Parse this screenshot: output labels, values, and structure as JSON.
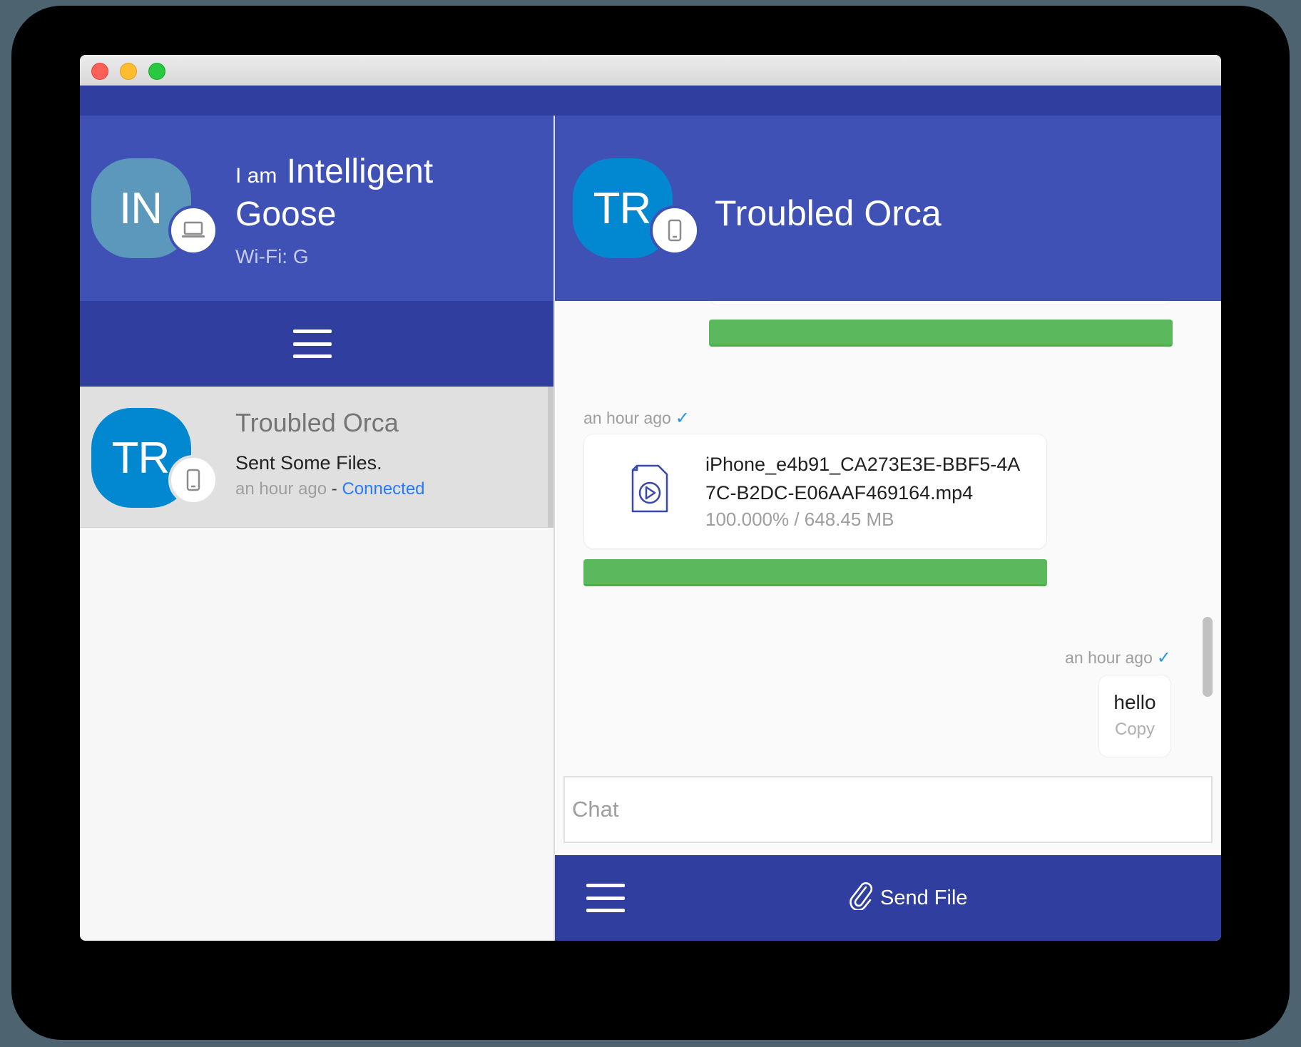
{
  "window": {
    "controls": [
      "close",
      "minimize",
      "zoom"
    ]
  },
  "me": {
    "initials": "IN",
    "prefix": "I am",
    "name": "Intelligent Goose",
    "network": "Wi-Fi: G",
    "device_icon": "laptop-icon"
  },
  "left_menu": {
    "icon": "hamburger-icon"
  },
  "peers": [
    {
      "initials": "TR",
      "name": "Troubled Orca",
      "last_message": "Sent Some Files.",
      "time": "an hour ago",
      "separator": " - ",
      "status": "Connected",
      "device_icon": "phone-icon"
    }
  ],
  "chat": {
    "peer_initials": "TR",
    "peer_name": "Troubled Orca",
    "messages": [
      {
        "type": "file",
        "progress": 1.0,
        "partial": true
      },
      {
        "type": "file",
        "time": "an hour ago",
        "status_icon": "check-icon",
        "file_name": "iPhone_e4b91_CA273E3E-BBF5-4A7C-B2DC-E06AAF469164.mp4",
        "file_progress": "100.000% / 648.45 MB",
        "progress": 1.0,
        "file_icon": "video-file-icon"
      },
      {
        "type": "text",
        "time": "an hour ago",
        "status_icon": "check-icon",
        "text": "hello",
        "action": "Copy"
      }
    ],
    "input_placeholder": "Chat",
    "input_value": "",
    "send_file_label": "Send File",
    "send_file_icon": "paperclip-icon",
    "menu_icon": "hamburger-icon"
  },
  "colors": {
    "primary": "#3f51b5",
    "primary_dark": "#303f9f",
    "success": "#5cb85c",
    "link": "#2979ff"
  }
}
